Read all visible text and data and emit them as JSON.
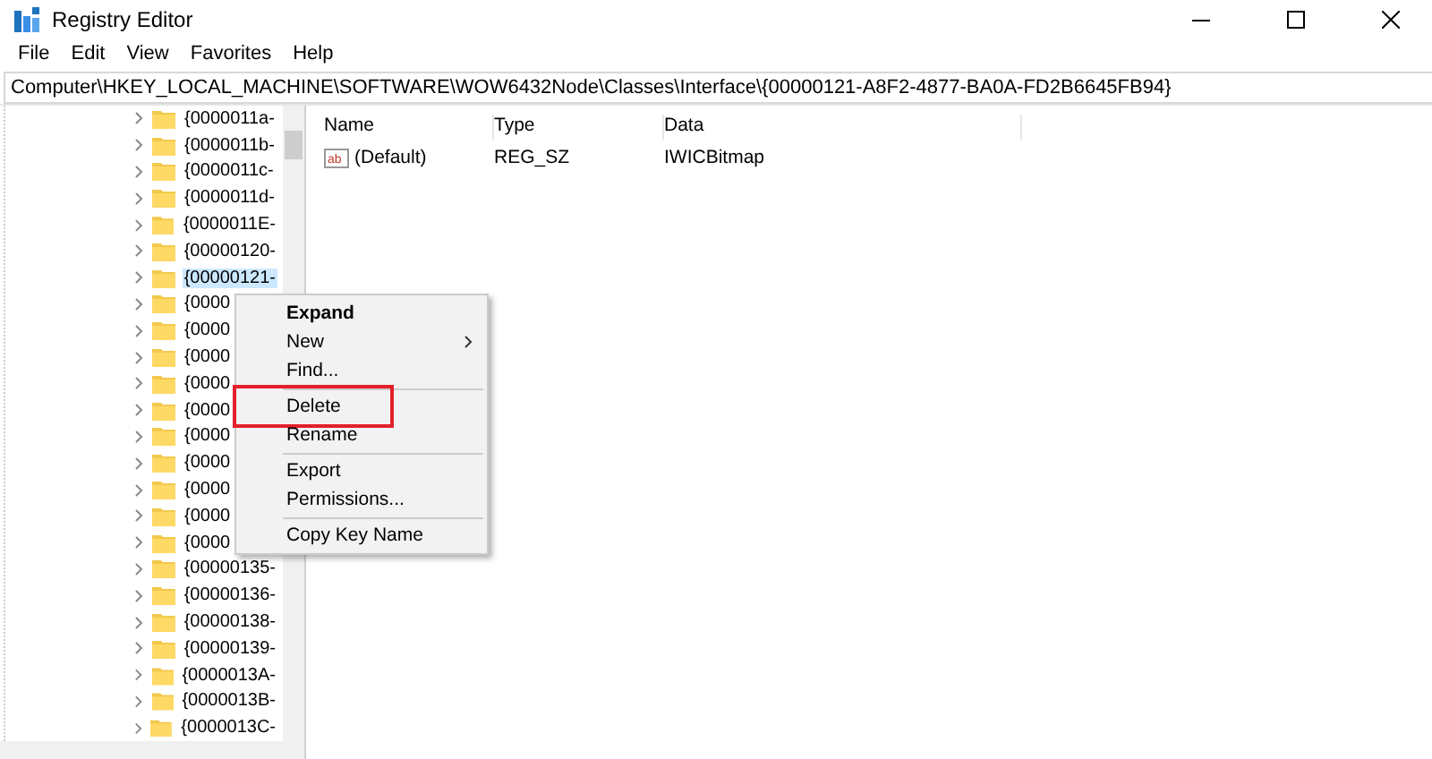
{
  "window": {
    "title": "Registry Editor"
  },
  "menu_bar": [
    "File",
    "Edit",
    "View",
    "Favorites",
    "Help"
  ],
  "address_bar": "Computer\\HKEY_LOCAL_MACHINE\\SOFTWARE\\WOW6432Node\\Classes\\Interface\\{00000121-A8F2-4877-BA0A-FD2B6645FB94}",
  "tree": {
    "items": [
      {
        "label": "{0000011a-",
        "selected": false
      },
      {
        "label": "{0000011b-",
        "selected": false
      },
      {
        "label": "{0000011c-",
        "selected": false
      },
      {
        "label": "{0000011d-",
        "selected": false
      },
      {
        "label": "{0000011E-",
        "selected": false
      },
      {
        "label": "{00000120-",
        "selected": false
      },
      {
        "label": "{00000121-",
        "selected": true
      },
      {
        "label": "{0000",
        "selected": false
      },
      {
        "label": "{0000",
        "selected": false
      },
      {
        "label": "{0000",
        "selected": false
      },
      {
        "label": "{0000",
        "selected": false
      },
      {
        "label": "{0000",
        "selected": false
      },
      {
        "label": "{0000",
        "selected": false
      },
      {
        "label": "{0000",
        "selected": false
      },
      {
        "label": "{0000",
        "selected": false
      },
      {
        "label": "{0000",
        "selected": false
      },
      {
        "label": "{0000",
        "selected": false
      },
      {
        "label": "{00000135-",
        "selected": false
      },
      {
        "label": "{00000136-",
        "selected": false
      },
      {
        "label": "{00000138-",
        "selected": false
      },
      {
        "label": "{00000139-",
        "selected": false
      },
      {
        "label": "{0000013A-",
        "selected": false
      },
      {
        "label": "{0000013B-",
        "selected": false
      },
      {
        "label": "{0000013C-",
        "selected": false
      }
    ]
  },
  "values_table": {
    "columns": [
      "Name",
      "Type",
      "Data"
    ],
    "rows": [
      {
        "icon_label": "ab",
        "name": "(Default)",
        "type": "REG_SZ",
        "data": "IWICBitmap"
      }
    ]
  },
  "context_menu": [
    {
      "kind": "item",
      "label": "Expand",
      "bold": true,
      "submenu": false,
      "highlighted": false
    },
    {
      "kind": "item",
      "label": "New",
      "bold": false,
      "submenu": true,
      "highlighted": false
    },
    {
      "kind": "item",
      "label": "Find...",
      "bold": false,
      "submenu": false,
      "highlighted": false
    },
    {
      "kind": "separator"
    },
    {
      "kind": "item",
      "label": "Delete",
      "bold": false,
      "submenu": false,
      "highlighted": true
    },
    {
      "kind": "item",
      "label": "Rename",
      "bold": false,
      "submenu": false,
      "highlighted": false
    },
    {
      "kind": "separator"
    },
    {
      "kind": "item",
      "label": "Export",
      "bold": false,
      "submenu": false,
      "highlighted": false
    },
    {
      "kind": "item",
      "label": "Permissions...",
      "bold": false,
      "submenu": false,
      "highlighted": false
    },
    {
      "kind": "separator"
    },
    {
      "kind": "item",
      "label": "Copy Key Name",
      "bold": false,
      "submenu": false,
      "highlighted": false
    }
  ]
}
